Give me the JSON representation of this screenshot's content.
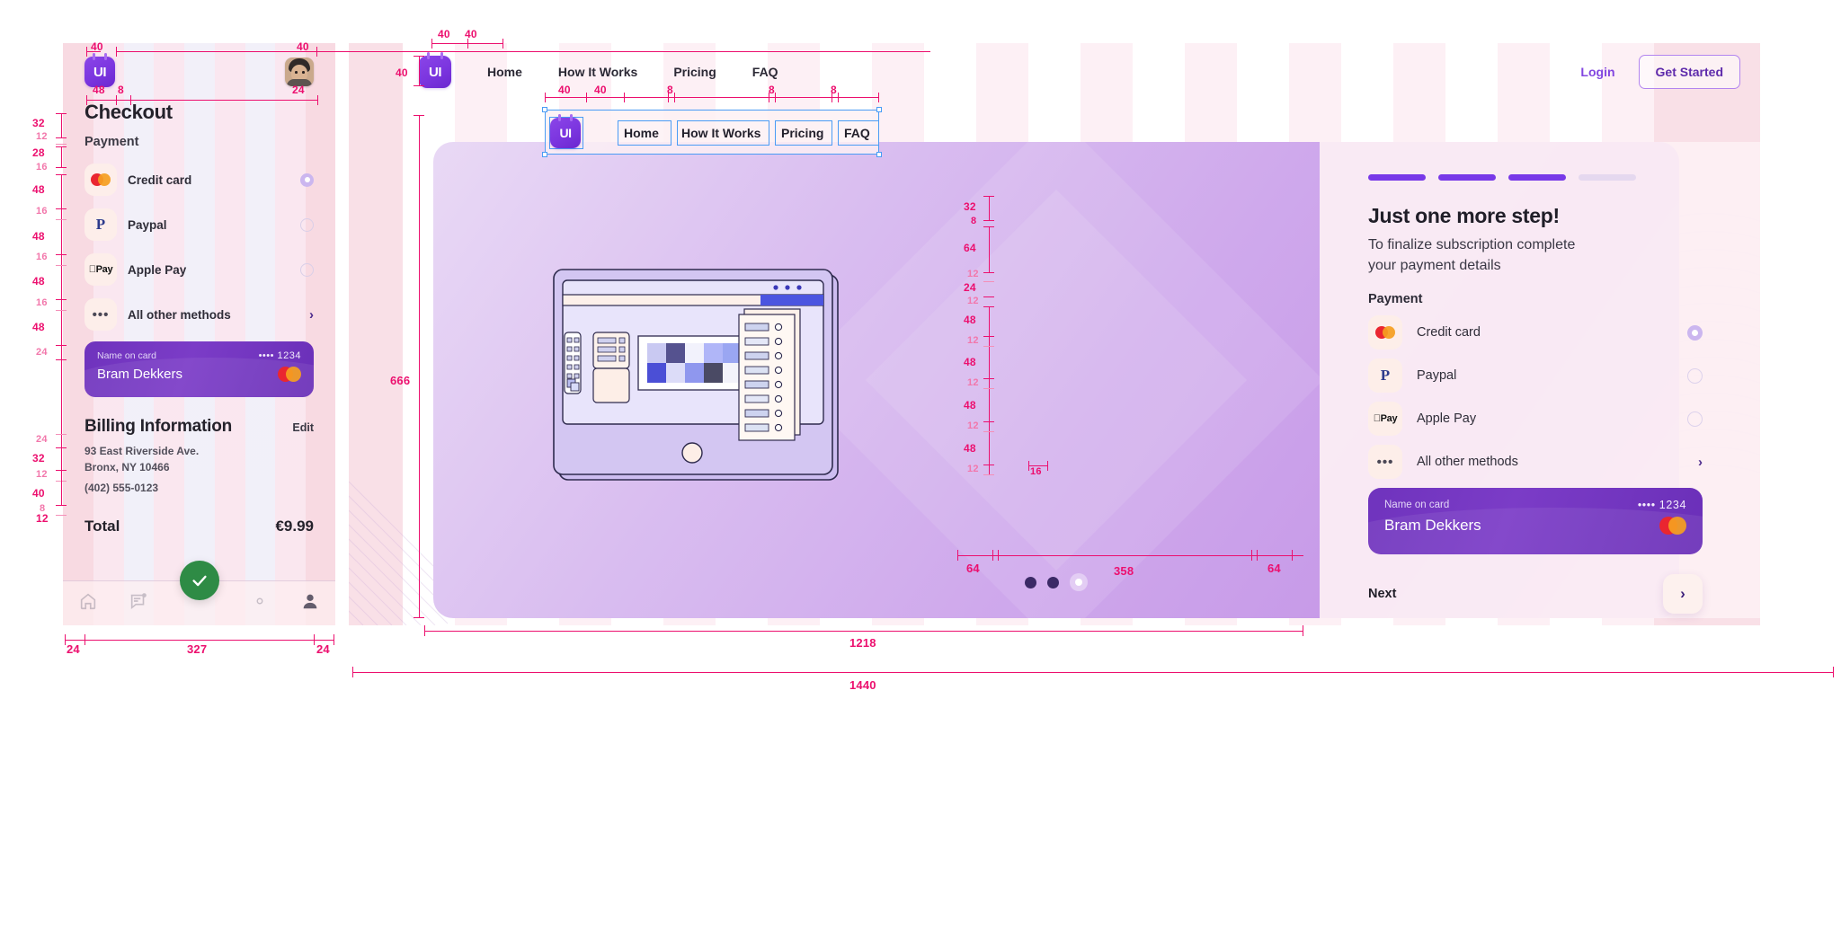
{
  "mobile": {
    "logo": "UI",
    "title": "Checkout",
    "section_payment": "Payment",
    "payment_methods": [
      {
        "name": "Credit card",
        "icon": "mastercard-icon",
        "control": "radio-selected"
      },
      {
        "name": "Paypal",
        "icon": "paypal-icon",
        "control": "radio"
      },
      {
        "name": "Apple Pay",
        "icon": "apple-pay-icon",
        "control": "radio"
      },
      {
        "name": "All other methods",
        "icon": "ellipsis-icon",
        "control": "chevron-right"
      }
    ],
    "card": {
      "label": "Name on card",
      "masked_number": "•••• 1234",
      "holder": "Bram Dekkers",
      "brand": "mastercard-icon"
    },
    "billing": {
      "title": "Billing Information",
      "edit": "Edit",
      "address_line1": "93 East Riverside Ave.",
      "address_line2": "Bronx, NY 10466",
      "phone": "(402) 555-0123"
    },
    "total_label": "Total",
    "total_value": "€9.99",
    "tabs": [
      {
        "icon": "home-icon",
        "active": false
      },
      {
        "icon": "messages-icon",
        "active": false
      },
      {
        "icon": "check-fab-icon",
        "active": true
      },
      {
        "icon": "gear-icon",
        "active": false
      },
      {
        "icon": "person-icon",
        "active": true
      }
    ]
  },
  "desktop": {
    "logo": "UI",
    "nav_links": [
      "Home",
      "How It Works",
      "Pricing",
      "FAQ"
    ],
    "login_label": "Login",
    "get_started_label": "Get Started",
    "panel": {
      "progress_steps": 4,
      "progress_filled": 3,
      "heading": "Just one more step!",
      "lead_line1": "To finalize subscription complete",
      "lead_line2": "your payment details",
      "section_payment": "Payment",
      "payment_methods": [
        {
          "name": "Credit card",
          "icon": "mastercard-icon",
          "control": "radio-selected"
        },
        {
          "name": "Paypal",
          "icon": "paypal-icon",
          "control": "radio"
        },
        {
          "name": "Apple Pay",
          "icon": "apple-pay-icon",
          "control": "radio"
        },
        {
          "name": "All other methods",
          "icon": "ellipsis-icon",
          "control": "chevron-right"
        }
      ],
      "card": {
        "label": "Name on card",
        "masked_number": "•••• 1234",
        "holder": "Bram Dekkers",
        "brand": "mastercard-icon"
      },
      "next_label": "Next",
      "next_icon": "chevron-right-icon"
    },
    "carousel_dots": 3,
    "carousel_active_index": 2
  },
  "annotations": {
    "mobile": {
      "top_left_40": "40",
      "top_right_40": "40",
      "logo_left_48": "48",
      "logo_gap_8": "8",
      "avatar_24": "24",
      "title_32": "32",
      "gap_12": "12",
      "payment_28": "28",
      "gap_16a": "16",
      "row_48a": "48",
      "gap_16b": "16",
      "row_48b": "48",
      "gap_16c": "16",
      "row_48c": "48",
      "gap_16d": "16",
      "row_48d": "48",
      "gap_24a": "24",
      "gap_24b": "24",
      "billing_32": "32",
      "gap_12b": "12",
      "address_40": "40",
      "gap_8": "8",
      "phone_12": "12",
      "bottom_left_24": "24",
      "bottom_width_327": "327",
      "bottom_right_24": "24"
    },
    "desktop": {
      "nav_40a": "40",
      "nav_40b": "40",
      "logo_h_40": "40",
      "sel_40a": "40",
      "sel_40b": "40",
      "sel_8a": "8",
      "sel_8b": "8",
      "sel_8c": "8",
      "hero_666": "666",
      "panel_32": "32",
      "panel_8": "8",
      "panel_64": "64",
      "panel_12a": "12",
      "panel_24": "24",
      "panel_12b": "12",
      "row_48a": "48",
      "gap_12a": "12",
      "row_48b": "48",
      "gap_12b": "12",
      "row_48c": "48",
      "gap_12c": "12",
      "row_48d": "48",
      "gap_12d": "12",
      "card_16": "16",
      "pad_64_left": "64",
      "card_width_358": "358",
      "pad_64_right": "64",
      "content_1218": "1218",
      "total_1440": "1440"
    }
  },
  "colors": {
    "accent_pink": "#ec0f6e",
    "accent_pink_soft": "#f48fb8",
    "brand_purple": "#7839e8",
    "success_green": "#2e8b45",
    "select_blue": "#4a9cf5"
  }
}
